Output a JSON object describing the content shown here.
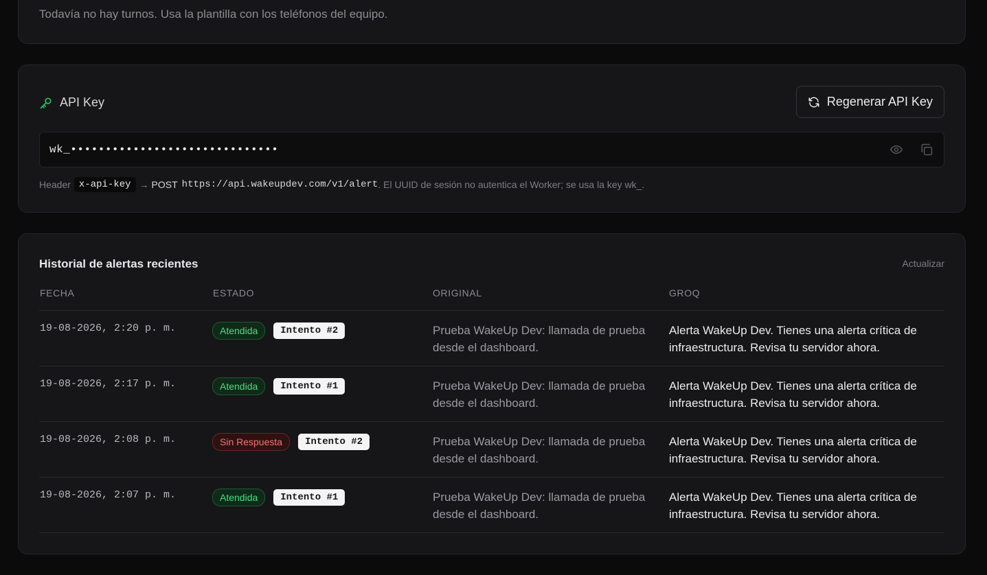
{
  "shifts": {
    "empty_message": "Todavía no hay turnos. Usa la plantilla con los teléfonos del equipo."
  },
  "api_key": {
    "title": "API Key",
    "regenerate_label": "Regenerar API Key",
    "masked_value": "wk_••••••••••••••••••••••••••••••",
    "help_prefix": "Header",
    "header_name": "x-api-key",
    "arrow": "→",
    "method": "POST",
    "endpoint": "https://api.wakeupdev.com/v1/alert",
    "help_suffix": ". El UUID de sesión no autentica el Worker; se usa la key wk_.",
    "icons": {
      "title_icon": "key-icon",
      "regenerate_icon": "refresh-icon",
      "reveal_icon": "eye-icon",
      "copy_icon": "copy-icon"
    },
    "accent_color": "#22c55e"
  },
  "history": {
    "title": "Historial de alertas recientes",
    "refresh_label": "Actualizar",
    "columns": {
      "date": "FECHA",
      "status": "ESTADO",
      "original": "ORIGINAL",
      "groq": "GROQ"
    },
    "rows": [
      {
        "date": "19-08-2026, 2:20 p. m.",
        "status": "Atendida",
        "status_type": "ok",
        "attempt": "Intento #2",
        "original": "Prueba WakeUp Dev: llamada de prueba desde el dashboard.",
        "groq": "Alerta WakeUp Dev. Tienes una alerta crítica de infraestructura. Revisa tu servidor ahora."
      },
      {
        "date": "19-08-2026, 2:17 p. m.",
        "status": "Atendida",
        "status_type": "ok",
        "attempt": "Intento #1",
        "original": "Prueba WakeUp Dev: llamada de prueba desde el dashboard.",
        "groq": "Alerta WakeUp Dev. Tienes una alerta crítica de infraestructura. Revisa tu servidor ahora."
      },
      {
        "date": "19-08-2026, 2:08 p. m.",
        "status": "Sin Respuesta",
        "status_type": "fail",
        "attempt": "Intento #2",
        "original": "Prueba WakeUp Dev: llamada de prueba desde el dashboard.",
        "groq": "Alerta WakeUp Dev. Tienes una alerta crítica de infraestructura. Revisa tu servidor ahora."
      },
      {
        "date": "19-08-2026, 2:07 p. m.",
        "status": "Atendida",
        "status_type": "ok",
        "attempt": "Intento #1",
        "original": "Prueba WakeUp Dev: llamada de prueba desde el dashboard.",
        "groq": "Alerta WakeUp Dev. Tienes una alerta crítica de infraestructura. Revisa tu servidor ahora."
      }
    ]
  }
}
